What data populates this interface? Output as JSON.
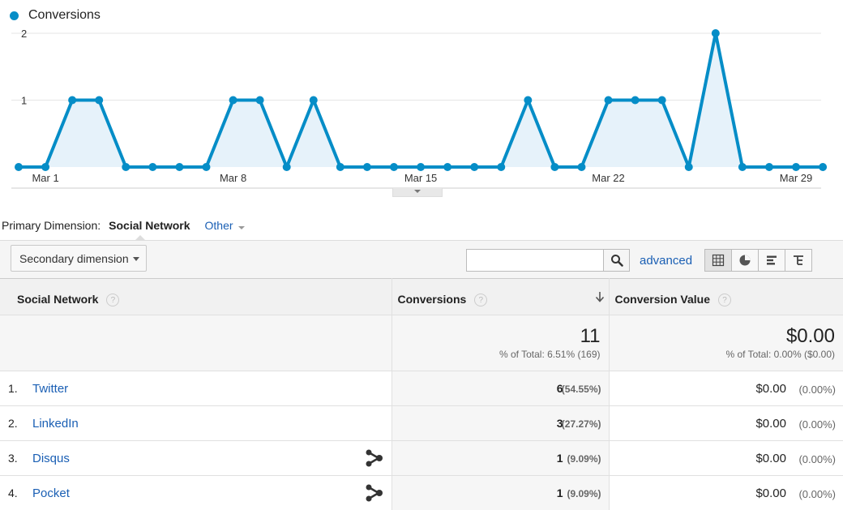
{
  "legend": {
    "label": "Conversions",
    "color": "#058dc7"
  },
  "chart_data": {
    "type": "area",
    "series": [
      {
        "name": "Conversions",
        "values": [
          0,
          0,
          1,
          1,
          0,
          0,
          0,
          0,
          1,
          1,
          0,
          1,
          0,
          0,
          0,
          0,
          0,
          0,
          0,
          1,
          0,
          0,
          1,
          1,
          1,
          0,
          2,
          0,
          0,
          0,
          0
        ]
      }
    ],
    "x_dates": [
      "Feb 28",
      "Mar 1",
      "Mar 2",
      "Mar 3",
      "Mar 4",
      "Mar 5",
      "Mar 6",
      "Mar 7",
      "Mar 8",
      "Mar 9",
      "Mar 10",
      "Mar 11",
      "Mar 12",
      "Mar 13",
      "Mar 14",
      "Mar 15",
      "Mar 16",
      "Mar 17",
      "Mar 18",
      "Mar 19",
      "Mar 20",
      "Mar 21",
      "Mar 22",
      "Mar 23",
      "Mar 24",
      "Mar 25",
      "Mar 26",
      "Mar 27",
      "Mar 28",
      "Mar 29",
      "Mar 30"
    ],
    "x_tick_labels": [
      "Mar 1",
      "Mar 8",
      "Mar 15",
      "Mar 22",
      "Mar 29"
    ],
    "y_tick_labels": [
      "2",
      "1"
    ],
    "ylim": [
      0,
      2
    ],
    "grid": true,
    "line_color": "#058dc7",
    "fill_color": "#e6f2fa"
  },
  "primary_dimension": {
    "label": "Primary Dimension:",
    "active": "Social Network",
    "other": "Other"
  },
  "toolbar": {
    "secondary_dimension": "Secondary dimension",
    "search_value": "",
    "advanced": "advanced",
    "views": [
      "table-icon",
      "pie-icon",
      "bar-icon",
      "pivot-icon"
    ]
  },
  "table": {
    "headers": {
      "dimension": "Social Network",
      "conversions": "Conversions",
      "value": "Conversion Value",
      "help": "?"
    },
    "totals": {
      "conversions": "11",
      "conversions_pct": "% of Total: 6.51% (169)",
      "value": "$0.00",
      "value_pct": "% of Total: 0.00% ($0.00)"
    },
    "rows": [
      {
        "index": "1.",
        "name": "Twitter",
        "conversions": "6",
        "conversions_pct": "(54.55%)",
        "value": "$0.00",
        "value_pct": "(0.00%)"
      },
      {
        "index": "2.",
        "name": "LinkedIn",
        "conversions": "3",
        "conversions_pct": "(27.27%)",
        "value": "$0.00",
        "value_pct": "(0.00%)"
      },
      {
        "index": "3.",
        "name": "Disqus",
        "conversions": "1",
        "conversions_pct": "(9.09%)",
        "value": "$0.00",
        "value_pct": "(0.00%)"
      },
      {
        "index": "4.",
        "name": "Pocket",
        "conversions": "1",
        "conversions_pct": "(9.09%)",
        "value": "$0.00",
        "value_pct": "(0.00%)"
      }
    ]
  }
}
